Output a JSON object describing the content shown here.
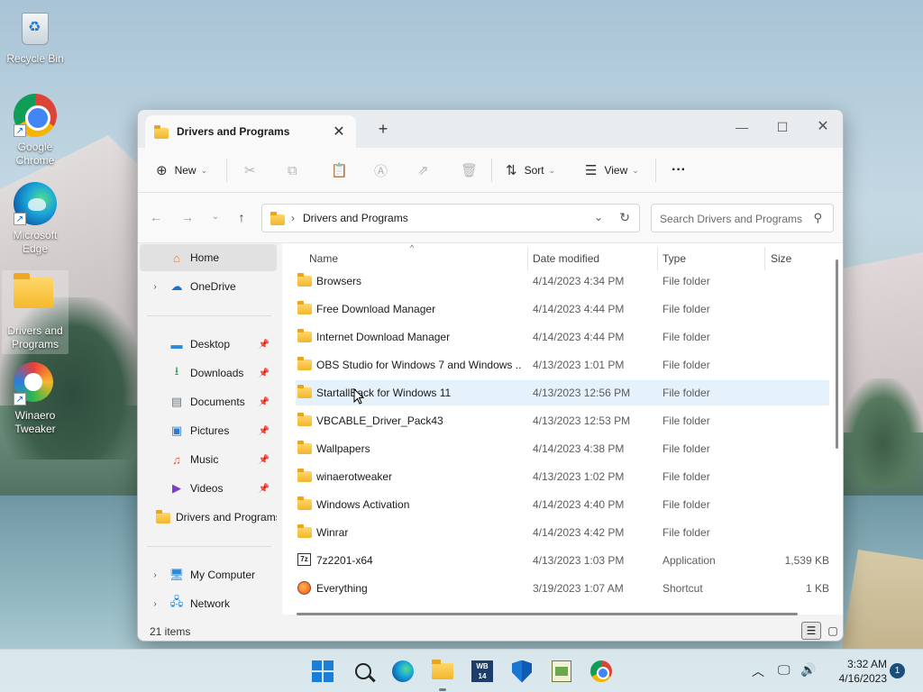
{
  "desktop": {
    "icons": [
      {
        "label": "Recycle Bin",
        "icon": "recycle-bin-icon"
      },
      {
        "label": "Google Chrome",
        "icon": "chrome-icon"
      },
      {
        "label": "Microsoft Edge",
        "icon": "edge-icon"
      },
      {
        "label": "Drivers and Programs",
        "icon": "folder-icon"
      },
      {
        "label": "Winaero Tweaker",
        "icon": "winaero-icon"
      }
    ]
  },
  "window": {
    "tab_title": "Drivers and Programs",
    "toolbar": {
      "new_label": "New",
      "sort_label": "Sort",
      "view_label": "View",
      "more_label": "···"
    },
    "address": {
      "path": "Drivers and Programs",
      "search_placeholder": "Search Drivers and Programs"
    },
    "sidebar": {
      "home": "Home",
      "onedrive": "OneDrive",
      "quick": [
        {
          "label": "Desktop",
          "icon": "desktop-icon",
          "color": "#2a8ad9"
        },
        {
          "label": "Downloads",
          "icon": "download-icon",
          "color": "#1f9d55"
        },
        {
          "label": "Documents",
          "icon": "documents-icon",
          "color": "#6d7a88"
        },
        {
          "label": "Pictures",
          "icon": "pictures-icon",
          "color": "#2b7bd1"
        },
        {
          "label": "Music",
          "icon": "music-icon",
          "color": "#e0533d"
        },
        {
          "label": "Videos",
          "icon": "videos-icon",
          "color": "#7a3fc4"
        },
        {
          "label": "Drivers and Programs",
          "icon": "folder-icon",
          "color": "#f3b52a"
        }
      ],
      "my_computer": "My Computer",
      "network": "Network"
    },
    "columns": {
      "name": "Name",
      "date": "Date modified",
      "type": "Type",
      "size": "Size"
    },
    "files": [
      {
        "name": "Browsers",
        "date": "4/14/2023 4:34 PM",
        "type": "File folder",
        "size": "",
        "kind": "folder"
      },
      {
        "name": "Free Download Manager",
        "date": "4/14/2023 4:44 PM",
        "type": "File folder",
        "size": "",
        "kind": "folder"
      },
      {
        "name": "Internet Download Manager",
        "date": "4/14/2023 4:44 PM",
        "type": "File folder",
        "size": "",
        "kind": "folder"
      },
      {
        "name": "OBS Studio for Windows 7 and Windows ...",
        "date": "4/13/2023 1:01 PM",
        "type": "File folder",
        "size": "",
        "kind": "folder"
      },
      {
        "name": "StartallBack for Windows 11",
        "date": "4/13/2023 12:56 PM",
        "type": "File folder",
        "size": "",
        "kind": "folder"
      },
      {
        "name": "VBCABLE_Driver_Pack43",
        "date": "4/13/2023 12:53 PM",
        "type": "File folder",
        "size": "",
        "kind": "folder"
      },
      {
        "name": "Wallpapers",
        "date": "4/14/2023 4:38 PM",
        "type": "File folder",
        "size": "",
        "kind": "folder"
      },
      {
        "name": "winaerotweaker",
        "date": "4/13/2023 1:02 PM",
        "type": "File folder",
        "size": "",
        "kind": "folder"
      },
      {
        "name": "Windows Activation",
        "date": "4/14/2023 4:40 PM",
        "type": "File folder",
        "size": "",
        "kind": "folder"
      },
      {
        "name": "Winrar",
        "date": "4/14/2023 4:42 PM",
        "type": "File folder",
        "size": "",
        "kind": "folder"
      },
      {
        "name": "7z2201-x64",
        "date": "4/13/2023 1:03 PM",
        "type": "Application",
        "size": "1,539 KB",
        "kind": "app"
      },
      {
        "name": "Everything",
        "date": "3/19/2023 1:07 AM",
        "type": "Shortcut",
        "size": "1 KB",
        "kind": "shortcut"
      }
    ],
    "status": "21 items"
  },
  "taskbar": {
    "time": "3:32 AM",
    "date": "4/16/2023",
    "notification_count": "1",
    "wb_label": "WB\n14"
  }
}
